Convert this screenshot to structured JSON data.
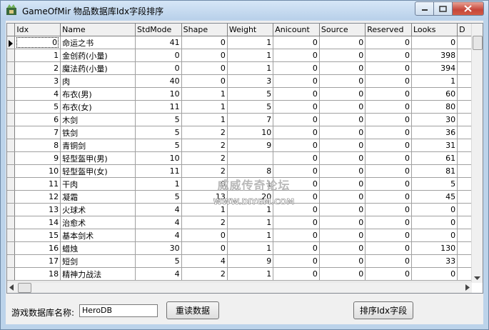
{
  "window": {
    "title": "GameOfMir 物品数据库Idx字段排序"
  },
  "grid": {
    "columns": [
      "Idx",
      "Name",
      "StdMode",
      "Shape",
      "Weight",
      "Anicount",
      "Source",
      "Reserved",
      "Looks",
      "D"
    ],
    "rows": [
      [
        "0",
        "命运之书",
        "41",
        "0",
        "1",
        "0",
        "0",
        "0",
        "0"
      ],
      [
        "1",
        "金创药(小量)",
        "0",
        "0",
        "1",
        "0",
        "0",
        "0",
        "398"
      ],
      [
        "2",
        "魔法药(小量)",
        "0",
        "0",
        "1",
        "0",
        "0",
        "0",
        "394"
      ],
      [
        "3",
        "肉",
        "40",
        "0",
        "3",
        "0",
        "0",
        "0",
        "1"
      ],
      [
        "4",
        "布衣(男)",
        "10",
        "1",
        "5",
        "0",
        "0",
        "0",
        "60"
      ],
      [
        "5",
        "布衣(女)",
        "11",
        "1",
        "5",
        "0",
        "0",
        "0",
        "80"
      ],
      [
        "6",
        "木剑",
        "5",
        "1",
        "7",
        "0",
        "0",
        "0",
        "30"
      ],
      [
        "7",
        "铁剑",
        "5",
        "2",
        "10",
        "0",
        "0",
        "0",
        "36"
      ],
      [
        "8",
        "青铜剑",
        "5",
        "2",
        "9",
        "0",
        "0",
        "0",
        "31"
      ],
      [
        "9",
        "轻型盔甲(男)",
        "10",
        "2",
        "",
        "0",
        "0",
        "0",
        "61"
      ],
      [
        "10",
        "轻型盔甲(女)",
        "11",
        "2",
        "8",
        "0",
        "0",
        "0",
        "81"
      ],
      [
        "11",
        "干肉",
        "1",
        "0",
        "1",
        "0",
        "0",
        "0",
        "5"
      ],
      [
        "12",
        "凝霜",
        "5",
        "13",
        "20",
        "0",
        "0",
        "0",
        "45"
      ],
      [
        "13",
        "火球术",
        "4",
        "1",
        "1",
        "0",
        "0",
        "0",
        "0"
      ],
      [
        "14",
        "治愈术",
        "4",
        "2",
        "1",
        "0",
        "0",
        "0",
        "0"
      ],
      [
        "15",
        "基本剑术",
        "4",
        "0",
        "1",
        "0",
        "0",
        "0",
        "0"
      ],
      [
        "16",
        "蜡烛",
        "30",
        "0",
        "1",
        "0",
        "0",
        "0",
        "130"
      ],
      [
        "17",
        "短剑",
        "5",
        "4",
        "9",
        "0",
        "0",
        "0",
        "33"
      ],
      [
        "18",
        "精神力战法",
        "4",
        "2",
        "1",
        "0",
        "0",
        "0",
        "0"
      ]
    ]
  },
  "footer": {
    "db_label": "游戏数据库名称:",
    "db_value": "HeroDB",
    "reload_label": "重读数据",
    "sort_label": "排序Idx字段"
  },
  "watermark": {
    "line1": "威威传奇论坛",
    "line2": "WWW.DIYGM.COM"
  }
}
